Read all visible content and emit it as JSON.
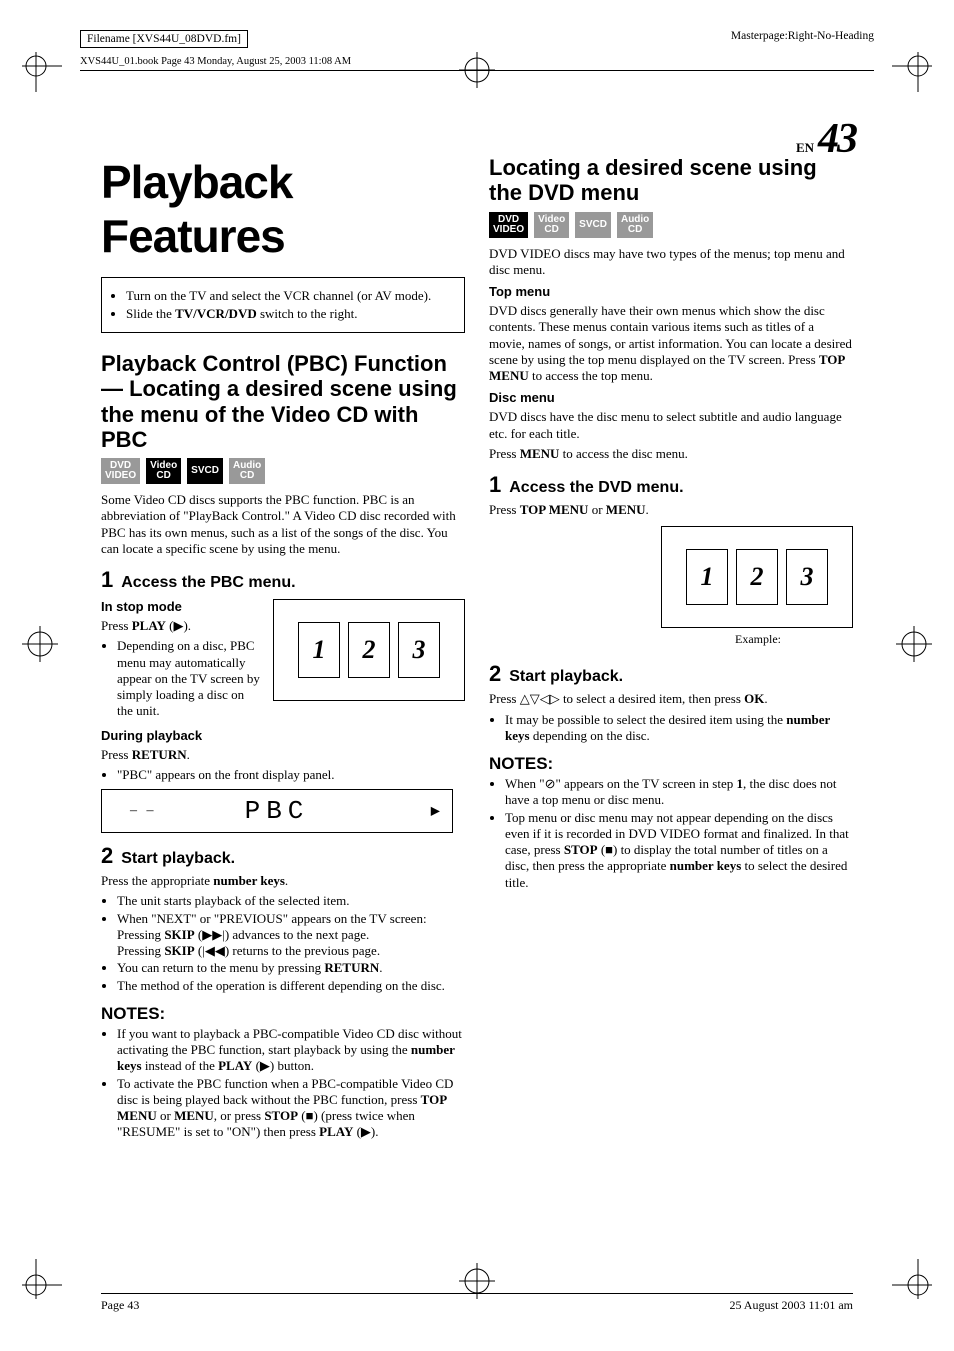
{
  "header": {
    "filename": "Filename [XVS44U_08DVD.fm]",
    "masterpage": "Masterpage:Right-No-Heading",
    "runhead_left": "XVS44U_01.book  Page 43  Monday, August 25, 2003  11:08 AM",
    "page_lang": "EN",
    "page_num": "43"
  },
  "left": {
    "title": "Playback Features",
    "intro_items": [
      "Turn on the TV and select the VCR channel (or AV mode).",
      "Slide the TV/VCR/DVD switch to the right."
    ],
    "intro_bold": "TV/VCR/DVD",
    "section1_title": "Playback Control (PBC) Function — Locating a desired scene using the menu of the Video CD with PBC",
    "disctypes": [
      {
        "l1": "DVD",
        "l2": "VIDEO",
        "dim": true
      },
      {
        "l1": "Video",
        "l2": "CD",
        "dim": false
      },
      {
        "l1": "SVCD",
        "l2": "",
        "dim": false
      },
      {
        "l1": "Audio",
        "l2": "CD",
        "dim": true
      }
    ],
    "pbc_intro": "Some Video CD discs supports the PBC function. PBC is an abbreviation of \"PlayBack Control.\" A Video CD disc recorded with PBC has its own menus, such as a list of the songs of the disc. You can locate a specific scene by using the menu.",
    "step1_num": "1",
    "step1_title": "Access the PBC menu.",
    "stop_mode_head": "In stop mode",
    "stop_mode_line": "Press PLAY (▶).",
    "stop_bullets": [
      "Depending on a disc, PBC menu may automatically appear on the TV screen by simply loading a disc on the unit."
    ],
    "during_head": "During playback",
    "during_line": "Press RETURN.",
    "during_bullets": [
      "\"PBC\" appears on the front display panel."
    ],
    "menu_cards": [
      "1",
      "2",
      "3"
    ],
    "lcd_dash": "– –",
    "lcd_text": "PBC",
    "lcd_play": "▶",
    "step2_num": "2",
    "step2_title": "Start playback.",
    "step2_line": "Press the appropriate number keys.",
    "step2_bullets": [
      "The unit starts playback of the selected item.",
      "When \"NEXT\" or \"PREVIOUS\" appears on the TV screen:",
      "You can return to the menu by pressing RETURN.",
      "The method of the operation is different depending on the disc."
    ],
    "step2_sub_a": "Pressing SKIP (▶▶|) advances to the next page.",
    "step2_sub_b": "Pressing SKIP (|◀◀) returns to the previous page.",
    "notes_title": "NOTES:",
    "notes": [
      "If you want to playback a PBC-compatible Video CD disc without activating the PBC function, start playback by using the number keys instead of the PLAY (▶) button.",
      "To activate the PBC function when a PBC-compatible Video CD disc is being played back without the PBC function, press TOP MENU or MENU, or press STOP (■) (press twice when \"RESUME\" is set to \"ON\") then press PLAY (▶)."
    ]
  },
  "right": {
    "section_title": "Locating a desired scene using the DVD menu",
    "disctypes": [
      {
        "l1": "DVD",
        "l2": "VIDEO",
        "dim": false
      },
      {
        "l1": "Video",
        "l2": "CD",
        "dim": true
      },
      {
        "l1": "SVCD",
        "l2": "",
        "dim": true
      },
      {
        "l1": "Audio",
        "l2": "CD",
        "dim": true
      }
    ],
    "intro": "DVD VIDEO discs may have two types of the menus; top menu and disc menu.",
    "top_head": "Top menu",
    "top_body": "DVD discs generally have their own menus which show the disc contents. These menus contain various items such as titles of a movie, names of songs, or artist information. You can locate a desired scene by using the top menu displayed on the TV screen. Press TOP MENU to access the top menu.",
    "disc_head": "Disc menu",
    "disc_body1": "DVD discs have the disc menu to select subtitle and audio language etc. for each title.",
    "disc_body2": "Press MENU to access the disc menu.",
    "step1_num": "1",
    "step1_title": "Access the DVD menu.",
    "step1_line": "Press TOP MENU or MENU.",
    "menu_cards": [
      "1",
      "2",
      "3"
    ],
    "example_label": "Example:",
    "step2_num": "2",
    "step2_title": "Start playback.",
    "step2_line": "Press △▽◁▷ to select a desired item, then press OK.",
    "step2_bullets": [
      "It may be possible to select the desired item using the number keys depending on the disc."
    ],
    "notes_title": "NOTES:",
    "notes": [
      "When \"⊘\" appears on the TV screen in step 1, the disc does not have a top menu or disc menu.",
      "Top menu or disc menu may not appear depending on the discs even if it is recorded in DVD VIDEO format and finalized. In that case, press STOP (■) to display the total number of titles on a disc, then press the appropriate number keys to select the desired title."
    ]
  },
  "footer": {
    "left": "Page 43",
    "right": "25 August 2003 11:01 am"
  }
}
